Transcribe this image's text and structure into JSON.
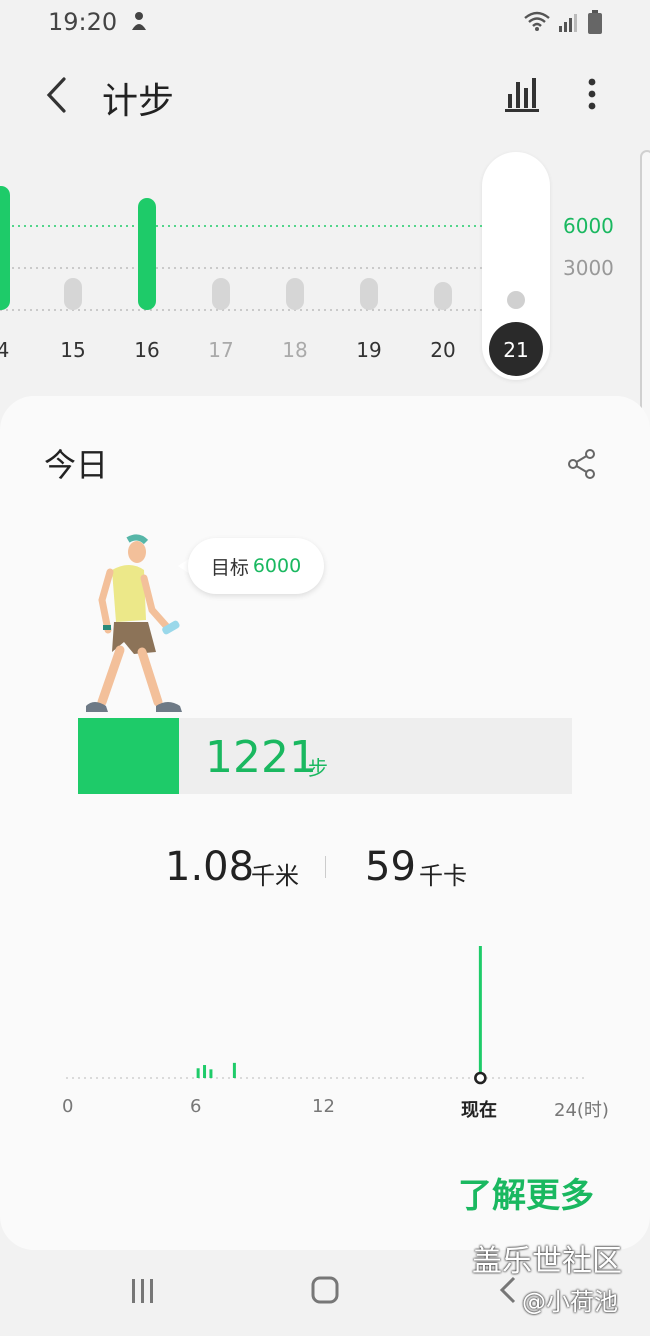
{
  "status_bar": {
    "time": "19:20"
  },
  "header": {
    "title": "计步"
  },
  "week_chart": {
    "goal_labels": [
      "6000",
      "3000"
    ],
    "days": [
      "4",
      "15",
      "16",
      "17",
      "18",
      "19",
      "20",
      "21"
    ],
    "selected_day": "21"
  },
  "today": {
    "title": "今日",
    "goal_prefix": "目标",
    "goal_value": "6000",
    "steps_value": "1221",
    "steps_unit": "步",
    "steps_progress": 0.2035,
    "distance_value": "1.08",
    "distance_unit": "千米",
    "calorie_value": "59",
    "calorie_unit": "千卡"
  },
  "chart_data": {
    "type": "bar",
    "x_ticks": [
      "0",
      "6",
      "12",
      "现在",
      "24(时)"
    ],
    "xlim": [
      0,
      24
    ],
    "bars": [
      {
        "hour": 6.1,
        "value": 90
      },
      {
        "hour": 6.4,
        "value": 120
      },
      {
        "hour": 6.7,
        "value": 80
      },
      {
        "hour": 7.8,
        "value": 140
      },
      {
        "hour": 19.33,
        "value": 1221
      }
    ]
  },
  "colors": {
    "accent": "#1ecb69",
    "accent_text": "#1ab860"
  },
  "learn_more": "了解更多",
  "watermark": {
    "title": "盖乐世社区",
    "user": "@小荷池"
  }
}
